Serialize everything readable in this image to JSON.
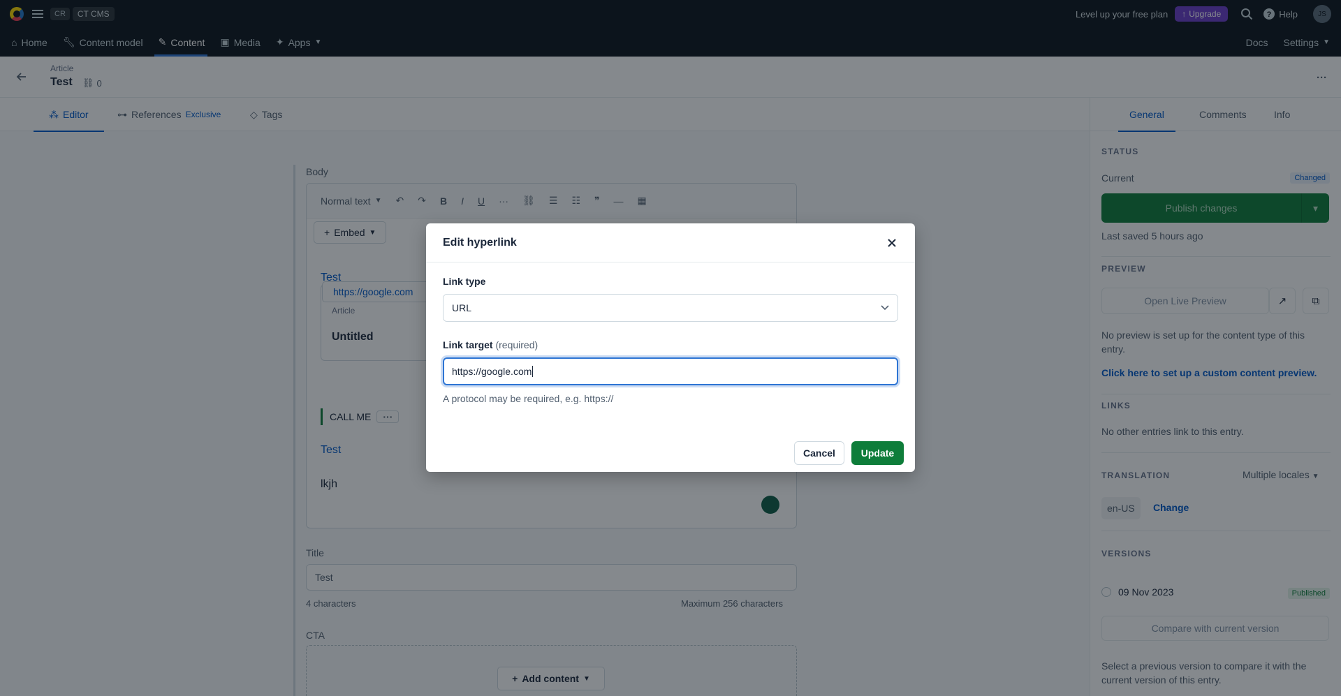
{
  "topbar": {
    "space_badge": "CR",
    "space_name": "CT CMS",
    "free_plan_text": "Level up your free plan",
    "upgrade_label": "Upgrade",
    "help_label": "Help",
    "avatar_initials": "JS",
    "nav": [
      {
        "label": "Home",
        "icon": "home-icon"
      },
      {
        "label": "Content model",
        "icon": "wrench-icon"
      },
      {
        "label": "Content",
        "icon": "feather-icon"
      },
      {
        "label": "Media",
        "icon": "image-icon"
      },
      {
        "label": "Apps",
        "icon": "puzzle-icon"
      }
    ],
    "docs_label": "Docs",
    "settings_label": "Settings"
  },
  "entry": {
    "content_type": "Article",
    "title": "Test",
    "references_count": "0"
  },
  "tabs": {
    "editor": "Editor",
    "references": "References",
    "references_sub": "Exclusive",
    "tags": "Tags"
  },
  "body_field": {
    "label": "Body",
    "format_select": "Normal text",
    "embed_label": "Embed",
    "link1": "Test",
    "link_tooltip": "https://google.com",
    "card_type": "Article",
    "card_name": "Untitled",
    "call_me": "CALL ME",
    "link2": "Test",
    "paragraph": "lkjh"
  },
  "title_field": {
    "label": "Title",
    "value": "Test",
    "char_count": "4 characters",
    "max_chars": "Maximum 256 characters"
  },
  "cta_field": {
    "label": "CTA",
    "add_content": "Add content"
  },
  "sidebar": {
    "tabs": [
      "General",
      "Comments",
      "Info"
    ],
    "status_heading": "STATUS",
    "current_label": "Current",
    "changed_badge": "Changed",
    "publish_label": "Publish changes",
    "last_saved": "Last saved 5 hours ago",
    "preview_heading": "PREVIEW",
    "open_live_preview": "Open Live Preview",
    "no_preview_text": "No preview is set up for the content type of this entry.",
    "setup_preview_link": "Click here to set up a custom content preview.",
    "links_heading": "LINKS",
    "no_links_text": "No other entries link to this entry.",
    "translation_heading": "TRANSLATION",
    "multiple_locales": "Multiple locales",
    "locale": "en-US",
    "change_label": "Change",
    "versions_heading": "VERSIONS",
    "version_date": "09 Nov 2023",
    "published_badge": "Published",
    "compare_label": "Compare with current version",
    "compare_help": "Select a previous version to compare it with the current version of this entry."
  },
  "modal": {
    "title": "Edit hyperlink",
    "link_type_label": "Link type",
    "link_type_value": "URL",
    "link_target_label": "Link target",
    "link_target_required": "(required)",
    "link_target_value": "https://google.com",
    "hint": "A protocol may be required, e.g. https://",
    "cancel_label": "Cancel",
    "update_label": "Update"
  },
  "colors": {
    "topbar_bg": "#0c141c",
    "accent_blue": "#0059c8",
    "primary_green": "#0e7d3a",
    "upgrade_purple": "#6b3cc9"
  }
}
